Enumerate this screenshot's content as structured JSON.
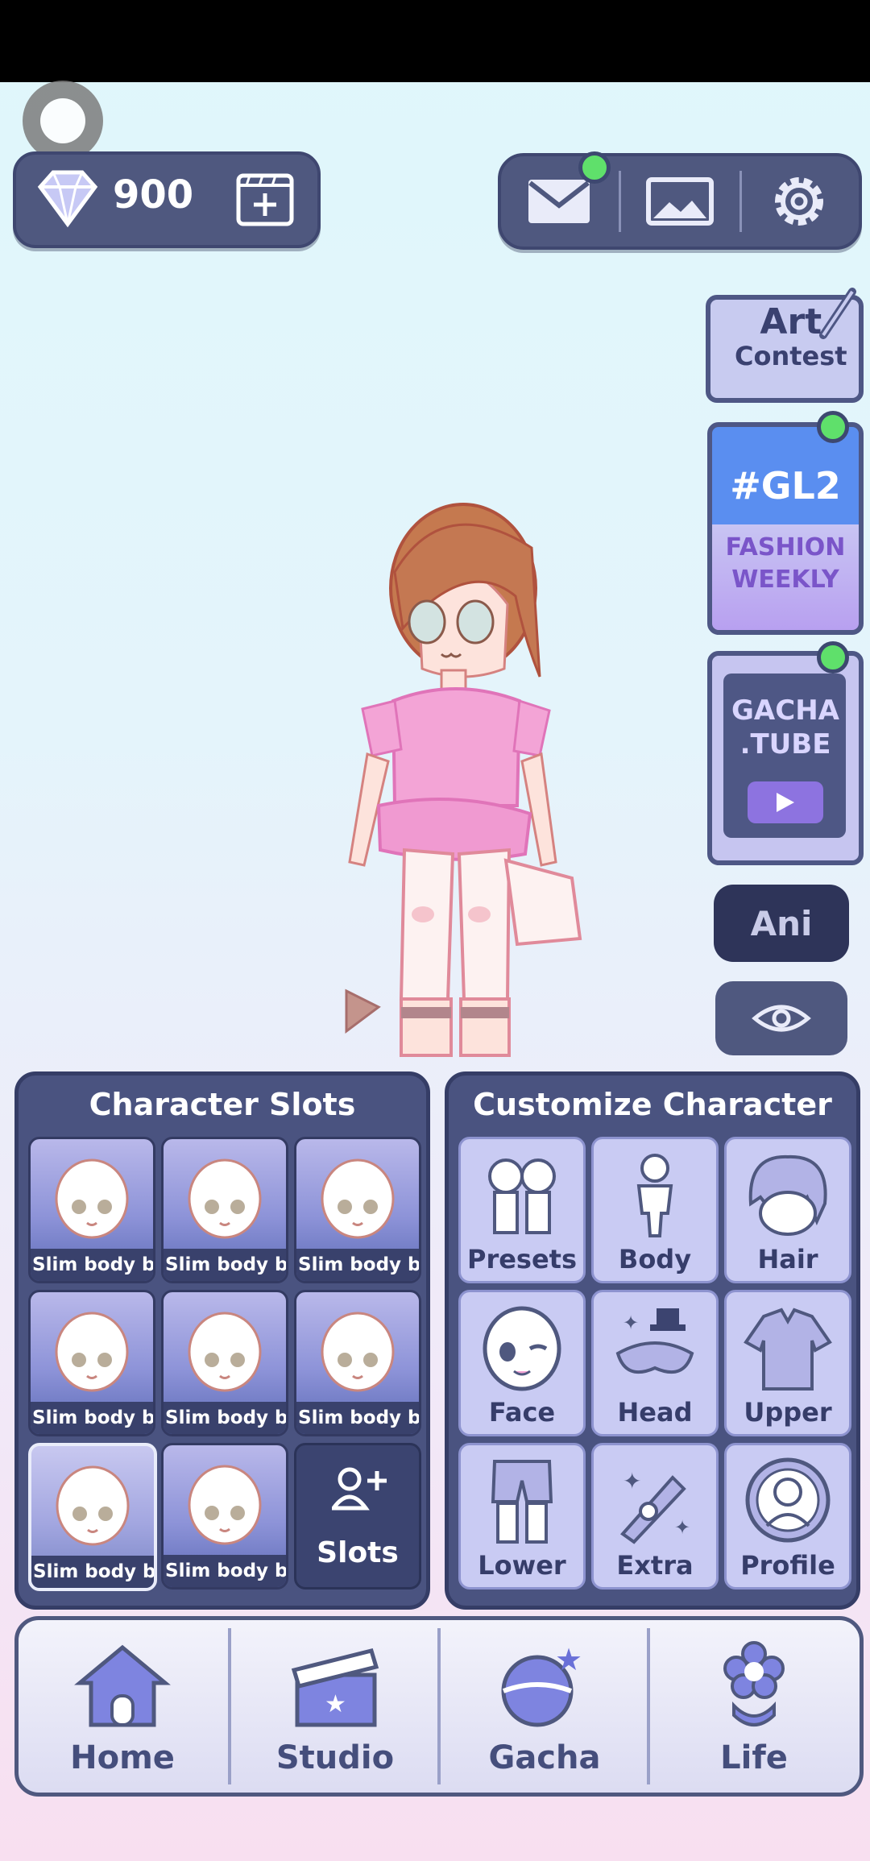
{
  "currency": {
    "gems": "900"
  },
  "side": {
    "art_contest": {
      "line1": "Art",
      "line2": "Contest"
    },
    "gl2": {
      "tag": "#GL2",
      "line1": "FASHION",
      "line2": "WEEKLY"
    },
    "gacha_tube": {
      "line1": "GACHA",
      "line2": ".TUBE"
    },
    "ani_label": "Ani"
  },
  "slots": {
    "title": "Character Slots",
    "items": [
      {
        "label": "Slim body bas"
      },
      {
        "label": "Slim body bas"
      },
      {
        "label": "Slim body bas"
      },
      {
        "label": "Slim body bas"
      },
      {
        "label": "Slim body bas"
      },
      {
        "label": "Slim body bas"
      },
      {
        "label": "Slim body bas"
      },
      {
        "label": "Slim body bas"
      }
    ],
    "add_label": "Slots"
  },
  "customize": {
    "title": "Customize Character",
    "items": [
      {
        "label": "Presets",
        "icon": "presets-icon"
      },
      {
        "label": "Body",
        "icon": "body-icon"
      },
      {
        "label": "Hair",
        "icon": "hair-icon"
      },
      {
        "label": "Face",
        "icon": "face-icon"
      },
      {
        "label": "Head",
        "icon": "head-icon"
      },
      {
        "label": "Upper",
        "icon": "upper-icon"
      },
      {
        "label": "Lower",
        "icon": "lower-icon"
      },
      {
        "label": "Extra",
        "icon": "extra-icon"
      },
      {
        "label": "Profile",
        "icon": "profile-icon"
      }
    ]
  },
  "nav": {
    "items": [
      {
        "label": "Home",
        "icon": "home-icon"
      },
      {
        "label": "Studio",
        "icon": "studio-icon"
      },
      {
        "label": "Gacha",
        "icon": "gacha-icon"
      },
      {
        "label": "Life",
        "icon": "life-icon"
      }
    ]
  },
  "colors": {
    "panel": "#4f587f",
    "notification": "#5fe06b",
    "accent": "#c9cbf3"
  }
}
